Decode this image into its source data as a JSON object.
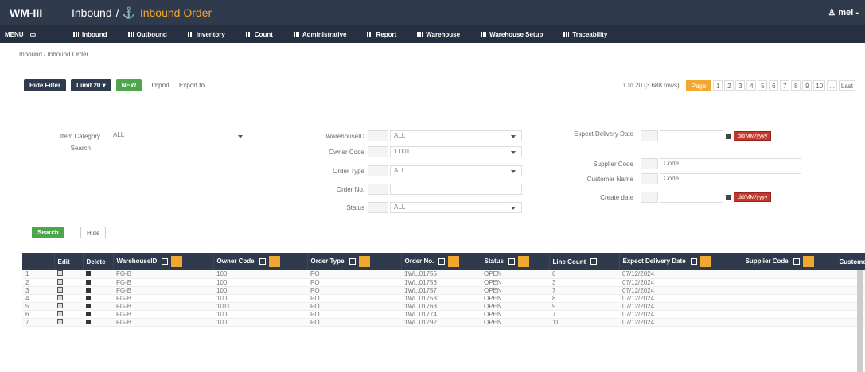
{
  "topbar": {
    "brand": "WM-III",
    "section": "Inbound",
    "sep": "/ ⚓",
    "page": "Inbound Order",
    "user": "♙ mei -"
  },
  "menubar": {
    "menu_label": "MENU",
    "items": [
      "Inbound",
      "Outbound",
      "Inventory",
      "Count",
      "Administrative",
      "Report",
      "Warehouse",
      "Warehouse Setup",
      "Traceability"
    ]
  },
  "breadcrumb": "Inbound / Inbound Order",
  "toolbar": {
    "hide_filter": "Hide Filter",
    "limit": "Limit 20",
    "new": "NEW",
    "import": "Import",
    "export": "Export to"
  },
  "pager": {
    "info": "1 to 20 (3 688 rows)",
    "page_select": "Page",
    "pages": [
      "1",
      "2",
      "3",
      "4",
      "5",
      "6",
      "7",
      "8",
      "9",
      "10",
      "...",
      "Last"
    ]
  },
  "filters": {
    "item_category_label": "Item Category",
    "item_category_value": "ALL",
    "search_label": "Search",
    "warehouse_label": "WarehouseID",
    "warehouse_value": "ALL",
    "owner_code_label": "Owner Code",
    "owner_code_value": "1 001",
    "order_type_label": "Order Type",
    "order_type_value": "ALL",
    "order_no_label": "Order No.",
    "status_label": "Status",
    "status_value": "ALL",
    "expect_delivery_label": "Expect Delivery Date",
    "supplier_code_label": "Supplier Code",
    "customer_name_label": "Customer Name",
    "create_date_label": "Create date",
    "date_value": "dd/MM/yyyy",
    "code_placeholder": "Code",
    "search_btn": "Search",
    "hide_btn": "Hide"
  },
  "table": {
    "headers": [
      "",
      "Edit",
      "Delete",
      "WarehouseID",
      "Owner Code",
      "Order Type",
      "Order No.",
      "Status",
      "Line Count",
      "Expect Delivery Date",
      "Supplier Code",
      "Custome"
    ],
    "rows": [
      [
        "1",
        "FG-B",
        "100",
        "PO",
        "1WL.01755",
        "OPEN",
        "6",
        "07/12/2024"
      ],
      [
        "2",
        "FG-B",
        "100",
        "PO",
        "1WL.01756",
        "OPEN",
        "3",
        "07/12/2024"
      ],
      [
        "3",
        "FG-B",
        "100",
        "PO",
        "1WL.01757",
        "OPEN",
        "7",
        "07/12/2024"
      ],
      [
        "4",
        "FG-B",
        "100",
        "PO",
        "1WL.01758",
        "OPEN",
        "8",
        "07/12/2024"
      ],
      [
        "5",
        "FG-B",
        "1011",
        "PO",
        "1WL.01763",
        "OPEN",
        "9",
        "07/12/2024"
      ],
      [
        "6",
        "FG-B",
        "100",
        "PO",
        "1WL.01774",
        "OPEN",
        "7",
        "07/12/2024"
      ],
      [
        "7",
        "FG-B",
        "100",
        "PO",
        "1WL.01792",
        "OPEN",
        "11",
        "07/12/2024"
      ]
    ]
  }
}
